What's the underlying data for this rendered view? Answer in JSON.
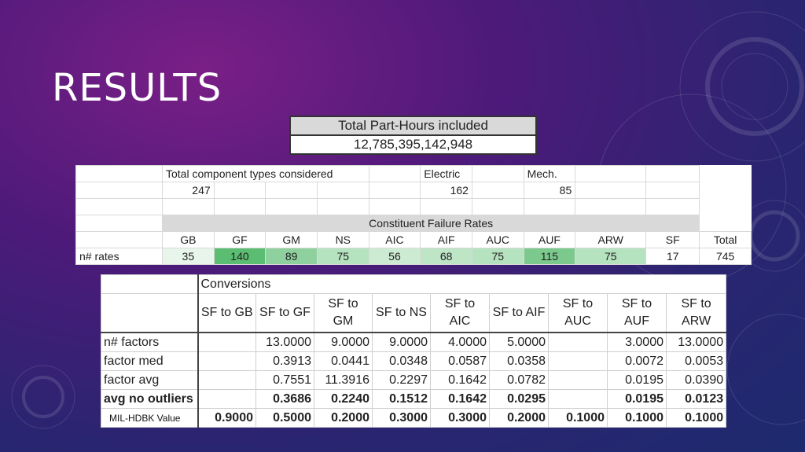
{
  "slide": {
    "title": "RESULTS"
  },
  "part_hours": {
    "label": "Total Part-Hours included",
    "value": "12,785,395,142,948"
  },
  "components": {
    "total_label": "Total component types considered",
    "total_value": "247",
    "electric_label": "Electric",
    "electric_value": "162",
    "mech_label": "Mech.",
    "mech_value": "85",
    "section_title": "Constituent Failure Rates",
    "row_label": "n# rates",
    "columns": [
      "GB",
      "GF",
      "GM",
      "NS",
      "AIC",
      "AIF",
      "AUC",
      "AUF",
      "ARW",
      "SF",
      "Total"
    ],
    "values": [
      "35",
      "140",
      "89",
      "75",
      "56",
      "68",
      "75",
      "115",
      "75",
      "17",
      "745"
    ],
    "fills": [
      "#e8f5ea",
      "#5bbd72",
      "#8fd19e",
      "#b5e2bf",
      "#cdebd3",
      "#bde5c6",
      "#b5e2bf",
      "#7cc98e",
      "#b5e2bf",
      "#ffffff",
      "#ffffff"
    ]
  },
  "conversions": {
    "title": "Conversions",
    "headers": [
      "SF to GB",
      "SF to GF",
      "SF to GM",
      "SF to NS",
      "SF to AIC",
      "SF to AIF",
      "SF to AUC",
      "SF to AUF",
      "SF to ARW"
    ],
    "rows": [
      {
        "label": "n# factors",
        "cells": [
          "",
          "13.0000",
          "9.0000",
          "9.0000",
          "4.0000",
          "5.0000",
          "",
          "3.0000",
          "13.0000"
        ]
      },
      {
        "label": "factor med",
        "cells": [
          "",
          "0.3913",
          "0.0441",
          "0.0348",
          "0.0587",
          "0.0358",
          "",
          "0.0072",
          "0.0053"
        ]
      },
      {
        "label": "factor avg",
        "cells": [
          "",
          "0.7551",
          "11.3916",
          "0.2297",
          "0.1642",
          "0.0782",
          "",
          "0.0195",
          "0.0390"
        ]
      },
      {
        "label": "avg no outliers",
        "cells": [
          "",
          "0.3686",
          "0.2240",
          "0.1512",
          "0.1642",
          "0.0295",
          "",
          "0.0195",
          "0.0123"
        ]
      }
    ],
    "mil_label": "MIL-HDBK Value",
    "mil_values": [
      "0.9000",
      "0.5000",
      "0.2000",
      "0.3000",
      "0.3000",
      "0.2000",
      "0.1000",
      "0.1000",
      "0.1000"
    ]
  }
}
